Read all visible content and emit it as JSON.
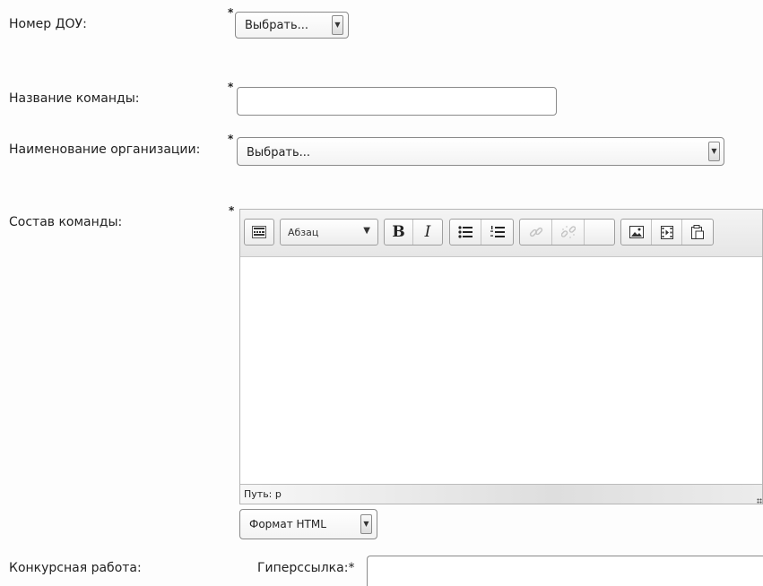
{
  "form": {
    "dou_number": {
      "label": "Номер ДОУ:",
      "required_mark": "*",
      "selected": "Выбрать..."
    },
    "team_name": {
      "label": "Название команды:",
      "required_mark": "*",
      "value": ""
    },
    "organization": {
      "label": "Наименование организации:",
      "required_mark": "*",
      "selected": "Выбрать..."
    },
    "team_members": {
      "label": "Состав команды:",
      "required_mark": "*",
      "editor": {
        "toolbar": {
          "format_select": "Абзац",
          "bold": "B",
          "italic": "I"
        },
        "path_label": "Путь: p",
        "content": ""
      },
      "format_select": "Формат HTML"
    },
    "contest_work": {
      "label": "Конкурсная работа:",
      "hyperlink_label": "Гиперссылка:*",
      "hyperlink_value": ""
    }
  }
}
